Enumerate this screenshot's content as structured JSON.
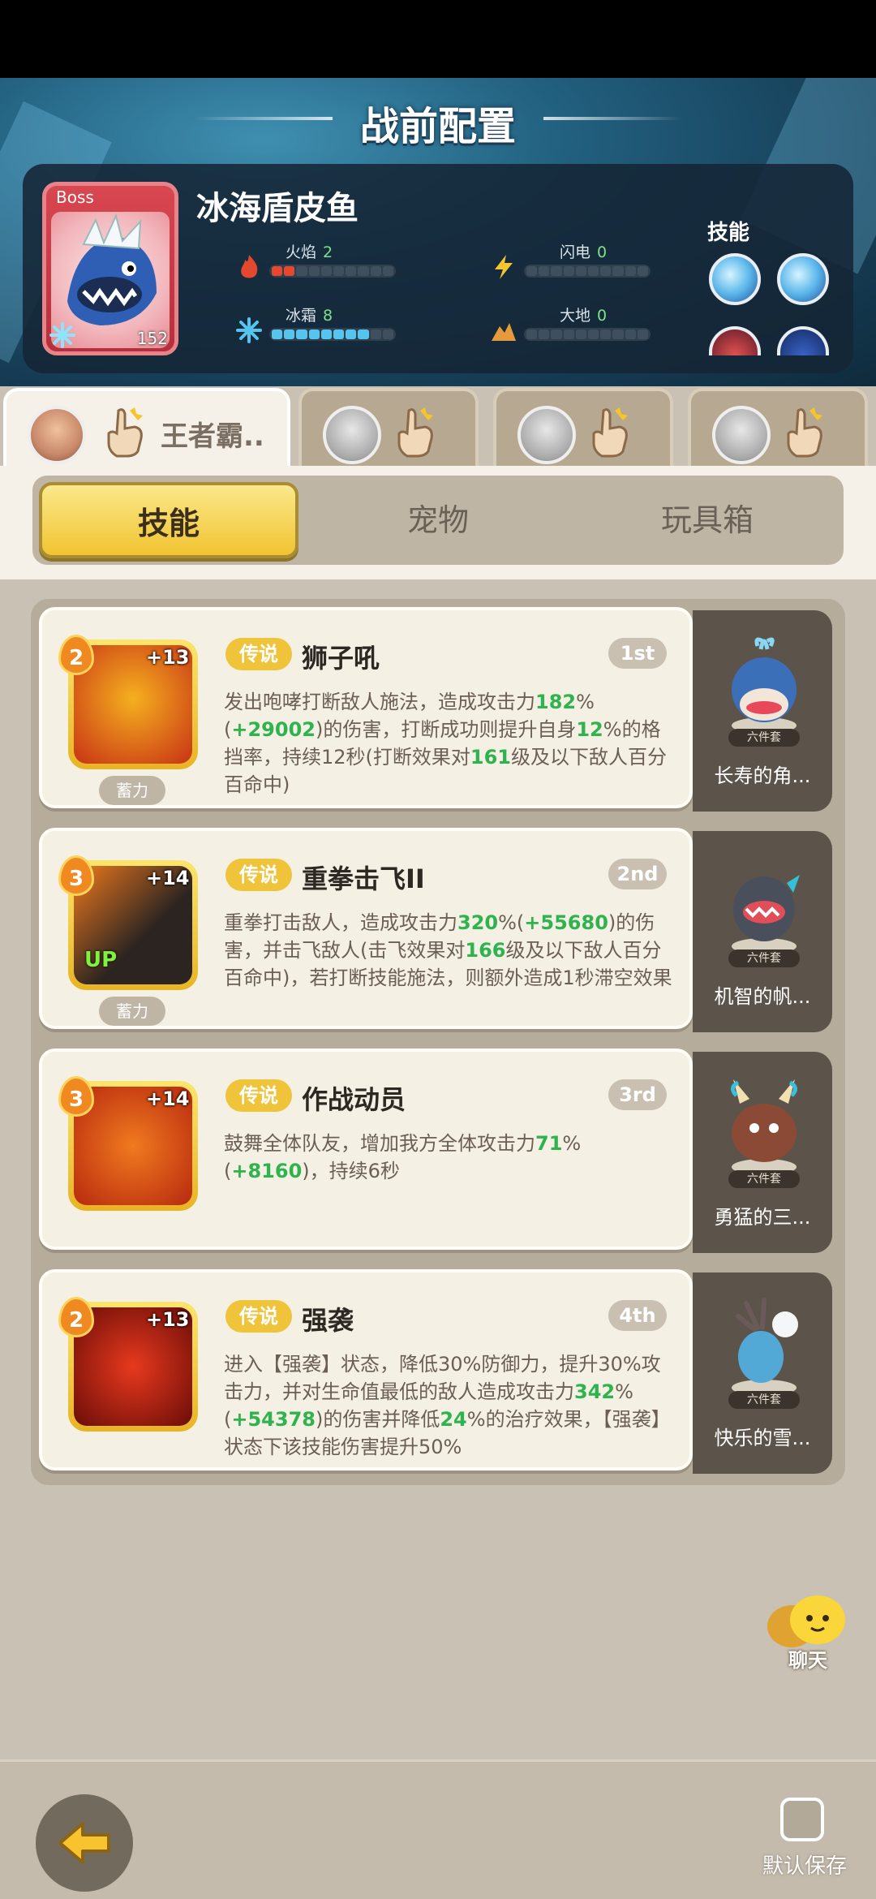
{
  "header": {
    "title": "战前配置"
  },
  "boss": {
    "tag": "Boss",
    "name": "冰海盾皮鱼",
    "level": "152",
    "stats": [
      {
        "label": "火焰",
        "value": "2",
        "icon": "fire-icon",
        "filled": 2,
        "color": "#e4492f"
      },
      {
        "label": "闪电",
        "value": "0",
        "icon": "lightning-icon",
        "filled": 0,
        "color": "#f3c62f"
      },
      {
        "label": "冰霜",
        "value": "8",
        "icon": "snowflake-icon",
        "filled": 8,
        "color": "#55c5ef"
      },
      {
        "label": "大地",
        "value": "0",
        "icon": "earth-icon",
        "filled": 0,
        "color": "#e59b3b"
      }
    ],
    "skills_label": "技能"
  },
  "hero_tabs": [
    {
      "name": "王者霸..",
      "active": true
    },
    {
      "name": "",
      "active": false
    },
    {
      "name": "",
      "active": false
    },
    {
      "name": "",
      "active": false
    }
  ],
  "main_tabs": [
    "技能",
    "宠物",
    "玩具箱"
  ],
  "skills": [
    {
      "rank": "2",
      "plus": "+13",
      "rarity": "传说",
      "name": "狮子吼",
      "order": "1st",
      "charge": "蓄力",
      "up": "",
      "desc": [
        {
          "t": "发出咆哮打断敌人施法，造成攻击力",
          "g": false
        },
        {
          "t": "182",
          "g": true
        },
        {
          "t": "%(",
          "g": false
        },
        {
          "t": "+29002",
          "g": true
        },
        {
          "t": ")的伤害，打断成功则提升自身",
          "g": false
        },
        {
          "t": "12",
          "g": true
        },
        {
          "t": "%的格挡率，持续12秒(打断效果对",
          "g": false
        },
        {
          "t": "161",
          "g": true
        },
        {
          "t": "级及以下敌人百分百命中)",
          "g": false
        }
      ],
      "pet": "长寿的角...",
      "pet_badge": "六件套",
      "colors": [
        "#f5b01f",
        "#c83215"
      ]
    },
    {
      "rank": "3",
      "plus": "+14",
      "rarity": "传说",
      "name": "重拳击飞II",
      "order": "2nd",
      "charge": "蓄力",
      "up": "UP",
      "desc": [
        {
          "t": "重拳打击敌人，造成攻击力",
          "g": false
        },
        {
          "t": "320",
          "g": true
        },
        {
          "t": "%(",
          "g": false
        },
        {
          "t": "+55680",
          "g": true
        },
        {
          "t": ")的伤害，并击飞敌人(击飞效果对",
          "g": false
        },
        {
          "t": "166",
          "g": true
        },
        {
          "t": "级及以下敌人百分百命中)，若打断技能施法，则额外造成1秒滞空效果",
          "g": false
        }
      ],
      "pet": "机智的帆...",
      "pet_badge": "六件套",
      "colors": [
        "#f07a1f",
        "#2b2420"
      ]
    },
    {
      "rank": "3",
      "plus": "+14",
      "rarity": "传说",
      "name": "作战动员",
      "order": "3rd",
      "charge": "",
      "up": "",
      "desc": [
        {
          "t": "鼓舞全体队友，增加我方全体攻击力",
          "g": false
        },
        {
          "t": "71",
          "g": true
        },
        {
          "t": "%(",
          "g": false
        },
        {
          "t": "+8160",
          "g": true
        },
        {
          "t": ")，持续6秒",
          "g": false
        }
      ],
      "pet": "勇猛的三...",
      "pet_badge": "六件套",
      "colors": [
        "#f07a1f",
        "#b8290f"
      ]
    },
    {
      "rank": "2",
      "plus": "+13",
      "rarity": "传说",
      "name": "强袭",
      "order": "4th",
      "charge": "",
      "up": "",
      "desc": [
        {
          "t": "进入【强袭】状态，降低30%防御力，提升30%攻击力，并对生命值最低的敌人造成攻击力",
          "g": false
        },
        {
          "t": "342",
          "g": true
        },
        {
          "t": "%(",
          "g": false
        },
        {
          "t": "+54378",
          "g": true
        },
        {
          "t": ")的伤害并降低",
          "g": false
        },
        {
          "t": "24",
          "g": true
        },
        {
          "t": "%的治疗效果，【强袭】状态下该技能伤害提升50%",
          "g": false
        }
      ],
      "pet": "快乐的雪...",
      "pet_badge": "六件套",
      "colors": [
        "#e8391e",
        "#6a0d08"
      ]
    }
  ],
  "chat": {
    "label": "聊天"
  },
  "footer": {
    "save_label": "默认保存"
  },
  "colors": {
    "accent": "#f1c431",
    "rarity": "#f0c43a",
    "highlight": "#2fb34e"
  }
}
